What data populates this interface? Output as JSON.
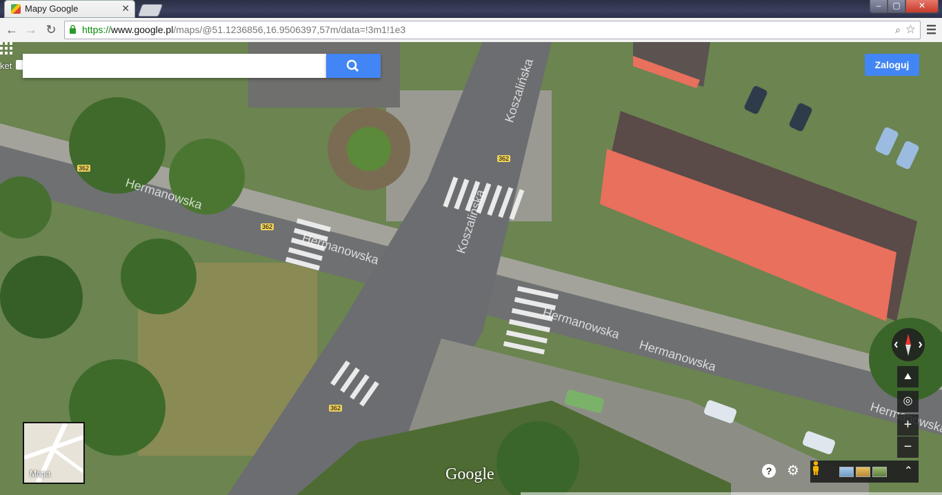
{
  "browser": {
    "tab_title": "Mapy Google",
    "url_scheme": "https://",
    "url_host": "www.google.pl",
    "url_rest": "/maps/@51.1236856,16.9506397,57m/data=!3m1!1e3",
    "window_buttons": {
      "minimize": "–",
      "maximize": "▢",
      "close": "✕"
    }
  },
  "map": {
    "search_placeholder": "",
    "edge_label": "ket",
    "sign_in": "Zaloguj",
    "minimap_label": "Mapa",
    "logo": "Google",
    "street_labels": {
      "hermanowska": "Hermanowska",
      "koszalinska": "Koszalińska",
      "route": "362"
    },
    "colors": {
      "accent": "#4285f4",
      "roof": "#e8705c"
    },
    "icons": [
      "search-icon",
      "apps-grid-icon",
      "compass-icon",
      "tilt-icon",
      "my-location-icon",
      "zoom-in-icon",
      "zoom-out-icon",
      "help-icon",
      "settings-icon",
      "pegman-icon",
      "expand-icon"
    ]
  }
}
